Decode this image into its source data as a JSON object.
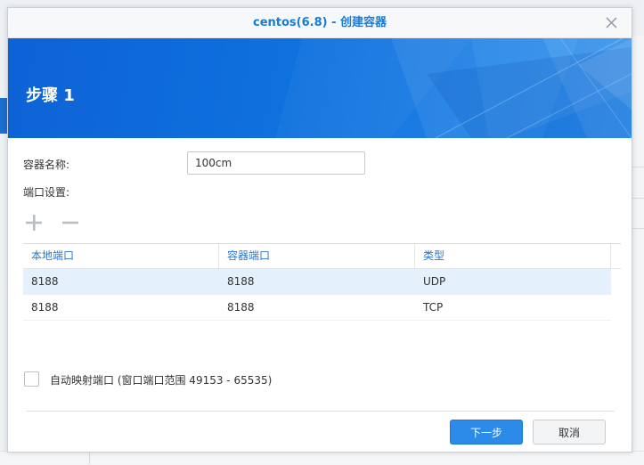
{
  "dialog": {
    "title": "centos(6.8) - 创建容器",
    "close_icon": "close-icon"
  },
  "banner": {
    "title": "步骤 1"
  },
  "form": {
    "container_name_label": "容器名称:",
    "container_name_value": "100cm",
    "port_settings_label": "端口设置:"
  },
  "toolbar": {
    "add_icon": "plus-icon",
    "remove_icon": "minus-icon"
  },
  "port_table": {
    "columns": [
      "本地端口",
      "容器端口",
      "类型"
    ],
    "rows": [
      {
        "local": "8188",
        "container": "8188",
        "type": "UDP",
        "selected": true
      },
      {
        "local": "8188",
        "container": "8188",
        "type": "TCP",
        "selected": false
      }
    ]
  },
  "auto_map": {
    "checked": false,
    "label": "自动映射端口 (窗口端口范围 49153 - 65535)"
  },
  "buttons": {
    "next": "下一步",
    "cancel": "取消"
  },
  "colors": {
    "accent": "#1a7bd5",
    "banner": "#0f6fdd",
    "primary_button": "#2c8ae8",
    "selected_row": "#e4f0fb"
  }
}
